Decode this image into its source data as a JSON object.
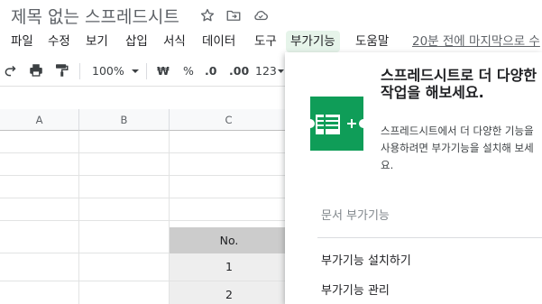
{
  "app": {
    "doc_title": "제목 없는 스프레드시트"
  },
  "menu": {
    "items": [
      {
        "label": "파일"
      },
      {
        "label": "수정"
      },
      {
        "label": "보기"
      },
      {
        "label": "삽입"
      },
      {
        "label": "서식"
      },
      {
        "label": "데이터"
      },
      {
        "label": "도구"
      },
      {
        "label": "부가기능",
        "active": true
      },
      {
        "label": "도움말"
      }
    ],
    "last_edit": "20분 전에 마지막으로 수"
  },
  "toolbar": {
    "zoom": "100%",
    "currency": "₩",
    "percent": "%",
    "decimal_decrease": ".0",
    "decimal_increase": ".00",
    "more_formats": "123"
  },
  "grid": {
    "columns": [
      "A",
      "B",
      "C"
    ],
    "cells": {
      "c_header": "No.",
      "c_values": [
        "1",
        "2"
      ]
    },
    "header_cell_color": "#cccccc",
    "shaded_cell_color": "#eeeeee"
  },
  "addon_menu": {
    "heading": "스프레드시트로 더 다양한 작업을 해보세요.",
    "description": "스프레드시트에서 더 다양한 기능을 사용하려면 부가기능을 설치해 보세요.",
    "section_label": "문서 부가기능",
    "items": [
      {
        "label": "부가기능 설치하기"
      },
      {
        "label": "부가기능 관리"
      }
    ],
    "icon": "sheets-addon-icon",
    "accent_color": "#0f9d58"
  }
}
